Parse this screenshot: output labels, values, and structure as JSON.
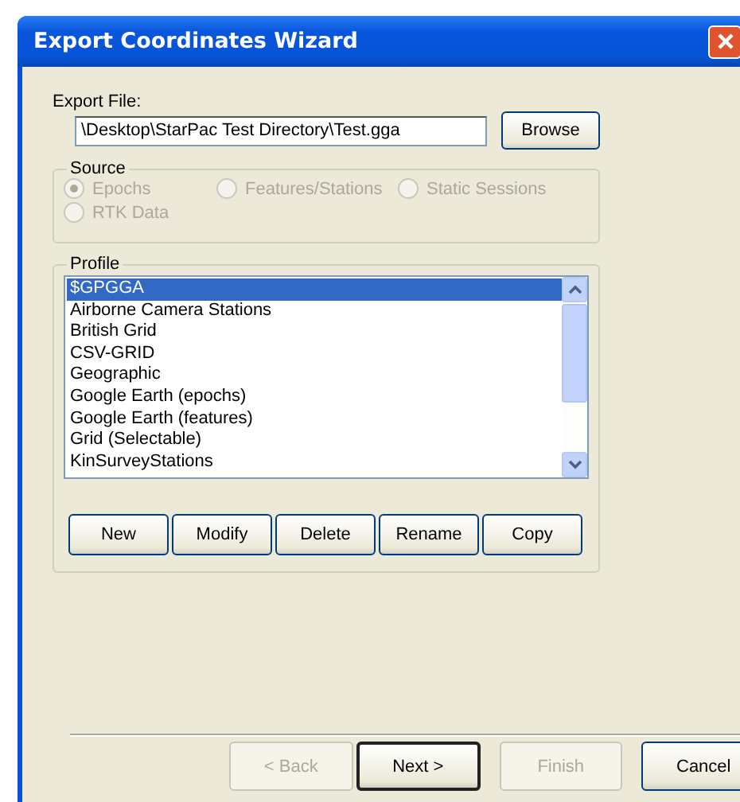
{
  "window": {
    "title": "Export Coordinates Wizard"
  },
  "export_file": {
    "label": "Export File:",
    "value": "\\Desktop\\StarPac Test Directory\\Test.gga",
    "browse": "Browse"
  },
  "source": {
    "title": "Source",
    "options": [
      {
        "label": "Epochs",
        "selected": true,
        "disabled": true
      },
      {
        "label": "Features/Stations",
        "selected": false,
        "disabled": true
      },
      {
        "label": "Static Sessions",
        "selected": false,
        "disabled": true
      },
      {
        "label": "RTK Data",
        "selected": false,
        "disabled": true
      }
    ]
  },
  "profile": {
    "title": "Profile",
    "items": [
      {
        "label": "$GPGGA",
        "selected": true
      },
      {
        "label": "Airborne Camera Stations",
        "selected": false
      },
      {
        "label": "British Grid",
        "selected": false
      },
      {
        "label": "CSV-GRID",
        "selected": false
      },
      {
        "label": "Geographic",
        "selected": false
      },
      {
        "label": "Google Earth (epochs)",
        "selected": false
      },
      {
        "label": "Google Earth (features)",
        "selected": false
      },
      {
        "label": "Grid (Selectable)",
        "selected": false
      },
      {
        "label": "KinSurveyStations",
        "selected": false
      }
    ],
    "buttons": [
      "New",
      "Modify",
      "Delete",
      "Rename",
      "Copy"
    ]
  },
  "footer": [
    {
      "label": "< Back",
      "disabled": true,
      "default": false
    },
    {
      "label": "Next >",
      "disabled": false,
      "default": true
    },
    {
      "label": "Finish",
      "disabled": true,
      "default": false
    },
    {
      "label": "Cancel",
      "disabled": false,
      "default": false
    }
  ]
}
